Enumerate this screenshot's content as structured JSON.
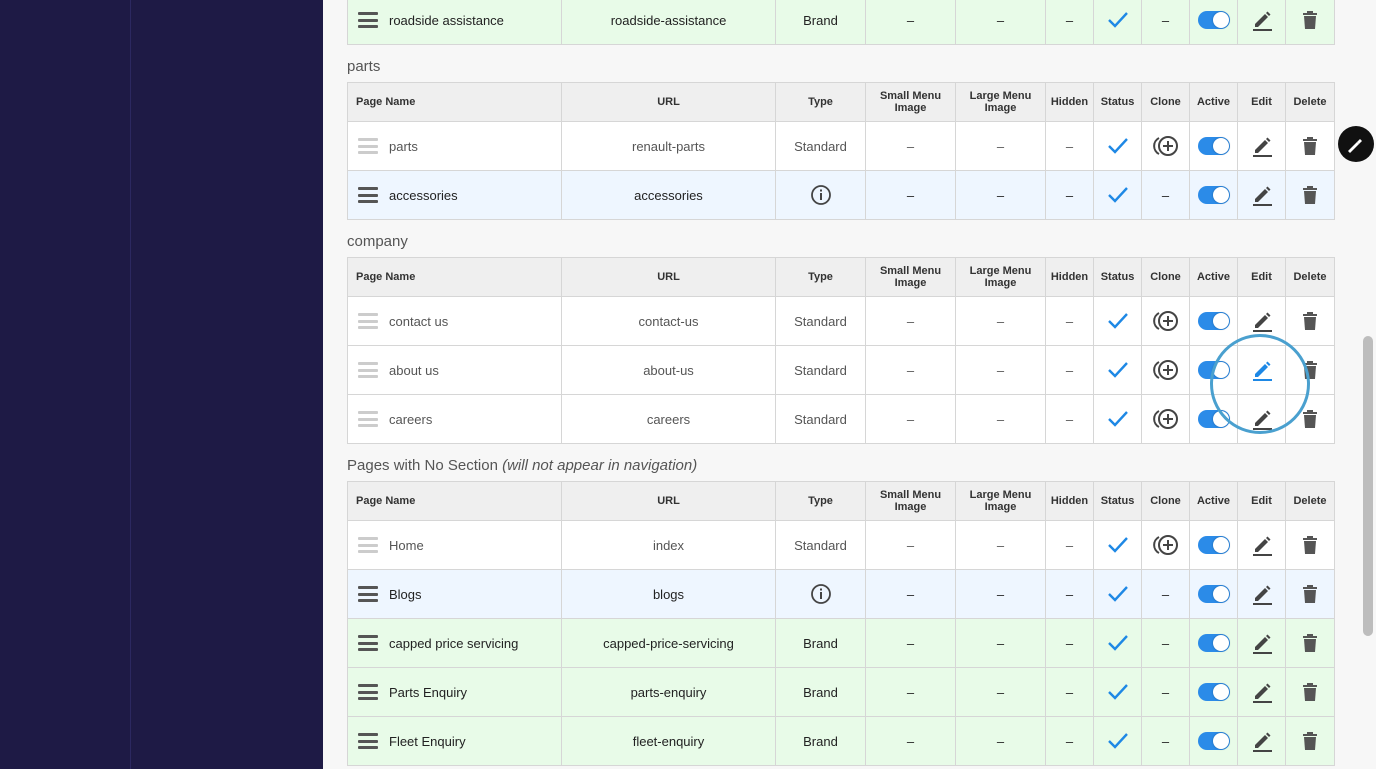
{
  "columns": [
    "Page Name",
    "URL",
    "Type",
    "Small Menu Image",
    "Large Menu Image",
    "Hidden",
    "Status",
    "Clone",
    "Active",
    "Edit",
    "Delete"
  ],
  "top_row": {
    "name": "roadside assistance",
    "url": "roadside-assistance",
    "type": "Brand",
    "small": "–",
    "large": "–",
    "hidden": "–",
    "status": "check-icon",
    "clone": "–"
  },
  "sections": [
    {
      "title": "parts",
      "note": "",
      "rows": [
        {
          "kind": "standard",
          "name": "parts",
          "url": "renault-parts",
          "type": "Standard",
          "small": "–",
          "large": "–",
          "hidden": "–",
          "clone": "clone-icon"
        },
        {
          "kind": "info",
          "name": "accessories",
          "url": "accessories",
          "type": "",
          "small": "–",
          "large": "–",
          "hidden": "–",
          "clone": "–"
        }
      ]
    },
    {
      "title": "company",
      "note": "",
      "rows": [
        {
          "kind": "standard",
          "name": "contact us",
          "url": "contact-us",
          "type": "Standard",
          "small": "–",
          "large": "–",
          "hidden": "–",
          "clone": "clone-icon"
        },
        {
          "kind": "standard",
          "name": "about us",
          "url": "about-us",
          "type": "Standard",
          "small": "–",
          "large": "–",
          "hidden": "–",
          "clone": "clone-icon"
        },
        {
          "kind": "standard",
          "name": "careers",
          "url": "careers",
          "type": "Standard",
          "small": "–",
          "large": "–",
          "hidden": "–",
          "clone": "clone-icon"
        }
      ]
    },
    {
      "title": "Pages with No Section",
      "note": "(will not appear in navigation)",
      "rows": [
        {
          "kind": "standard",
          "name": "Home",
          "url": "index",
          "type": "Standard",
          "small": "–",
          "large": "–",
          "hidden": "–",
          "clone": "clone-icon"
        },
        {
          "kind": "info",
          "name": "Blogs",
          "url": "blogs",
          "type": "",
          "small": "–",
          "large": "–",
          "hidden": "–",
          "clone": "–"
        },
        {
          "kind": "brand",
          "name": "capped price servicing",
          "url": "capped-price-servicing",
          "type": "Brand",
          "small": "–",
          "large": "–",
          "hidden": "–",
          "clone": "–"
        },
        {
          "kind": "brand",
          "name": "Parts Enquiry",
          "url": "parts-enquiry",
          "type": "Brand",
          "small": "–",
          "large": "–",
          "hidden": "–",
          "clone": "–"
        },
        {
          "kind": "brand",
          "name": "Fleet Enquiry",
          "url": "fleet-enquiry",
          "type": "Brand",
          "small": "–",
          "large": "–",
          "hidden": "–",
          "clone": "–"
        }
      ]
    }
  ],
  "colors": {
    "sidebar": "#1e1a45",
    "accent": "#1e88e5",
    "brand_row": "#e8fbe8",
    "info_row": "#eef6ff"
  }
}
